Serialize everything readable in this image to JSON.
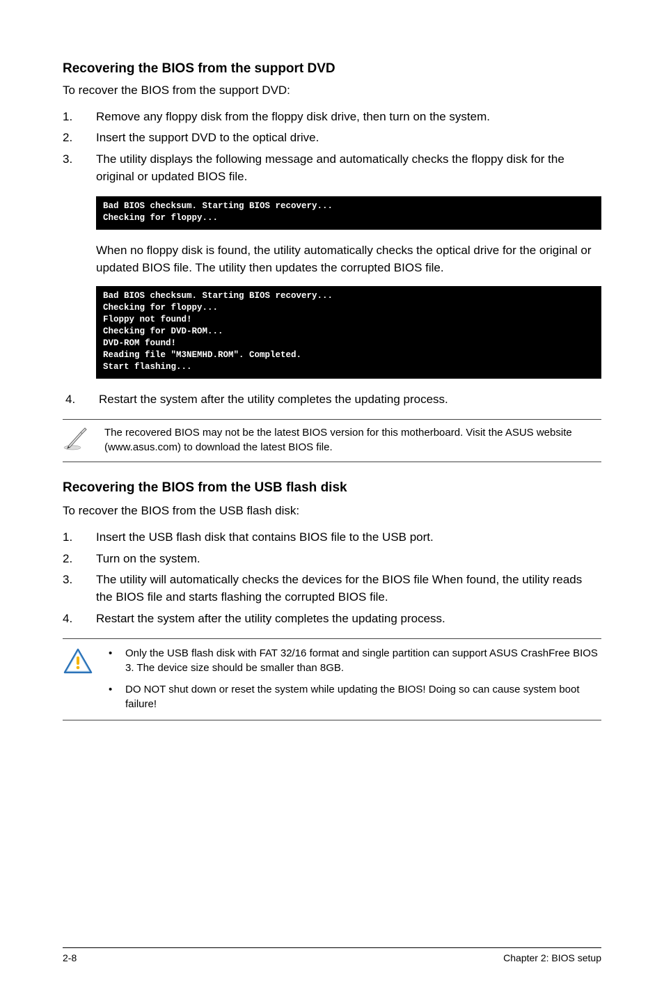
{
  "section1": {
    "heading": "Recovering the BIOS from the support DVD",
    "intro": "To recover the BIOS from the support DVD:",
    "steps": [
      "Remove any floppy disk from the floppy disk drive, then turn on the system.",
      "Insert the support DVD to the optical drive.",
      "The utility displays the following message and automatically checks the floppy disk for the original or updated BIOS file."
    ],
    "terminal1": "Bad BIOS checksum. Starting BIOS recovery...\nChecking for floppy...",
    "para_after_t1": "When no floppy disk is found, the utility automatically checks the optical drive for the original or updated BIOS file. The utility then updates the corrupted BIOS file.",
    "terminal2": "Bad BIOS checksum. Starting BIOS recovery...\nChecking for floppy...\nFloppy not found!\nChecking for DVD-ROM...\nDVD-ROM found!\nReading file \"M3NEMHD.ROM\". Completed.\nStart flashing...",
    "step4": "Restart the system after the utility completes the updating process.",
    "note": "The recovered BIOS may not be the latest BIOS version for this motherboard. Visit the ASUS website (www.asus.com) to download the latest BIOS file."
  },
  "section2": {
    "heading": "Recovering the BIOS from the USB flash disk",
    "intro": "To recover the BIOS from the USB flash disk:",
    "steps": [
      "Insert the USB flash disk that contains BIOS file to the USB port.",
      "Turn on the system.",
      "The utility will automatically checks the devices for the BIOS file When found, the utility reads the BIOS file and starts flashing the corrupted BIOS file.",
      "Restart the system after the utility completes the updating process."
    ],
    "warnings": [
      "Only the USB flash disk with FAT 32/16 format and single partition can support ASUS CrashFree BIOS 3. The device size should be smaller than 8GB.",
      "DO NOT shut down or reset the system while updating the BIOS! Doing so can cause system boot failure!"
    ]
  },
  "footer": {
    "left": "2-8",
    "right": "Chapter 2: BIOS setup"
  },
  "icons": {
    "pen": "pen-note-icon",
    "warn": "warning-triangle-icon"
  }
}
